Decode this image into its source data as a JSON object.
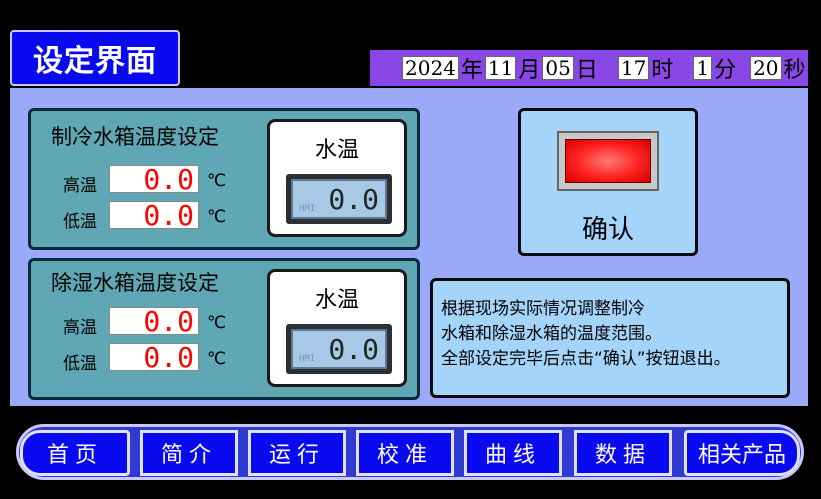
{
  "title": "设定界面",
  "datetime": {
    "year": "2024",
    "year_unit": "年",
    "month": "11",
    "month_unit": "月",
    "day": "05",
    "day_unit": "日",
    "hour": "17",
    "hour_unit": "时",
    "minute": "1",
    "minute_unit": "分",
    "second": "20",
    "second_unit": "秒"
  },
  "cooling_panel": {
    "title": "制冷水箱温度设定",
    "high_label": "高温",
    "high_value": "0.0",
    "low_label": "低温",
    "low_value": "0.0",
    "unit": "℃",
    "water_temp_label": "水温",
    "water_temp_value": "0.0",
    "lcd_brand": "HMI"
  },
  "dehumid_panel": {
    "title": "除湿水箱温度设定",
    "high_label": "高温",
    "high_value": "0.0",
    "low_label": "低温",
    "low_value": "0.0",
    "unit": "℃",
    "water_temp_label": "水温",
    "water_temp_value": "0.0",
    "lcd_brand": "HMI"
  },
  "confirm": {
    "label": "确认",
    "lamp_color": "#ff2020"
  },
  "info": {
    "lines": [
      "根据现场实际情况调整制冷",
      "水箱和除湿水箱的温度范围。",
      "全部设定完毕后点击“确认”按钮退出。"
    ]
  },
  "nav": {
    "items": [
      "首页",
      "简介",
      "运行",
      "校准",
      "曲线",
      "数据",
      "相关产品"
    ]
  },
  "colors": {
    "title_bg": "#0a0af0",
    "datebar_bg": "#8a47e8",
    "main_bg": "#9aaaf8",
    "panel_bg": "#5fa7b5",
    "info_bg": "#a5d4fb",
    "value_text": "#ff0000"
  }
}
